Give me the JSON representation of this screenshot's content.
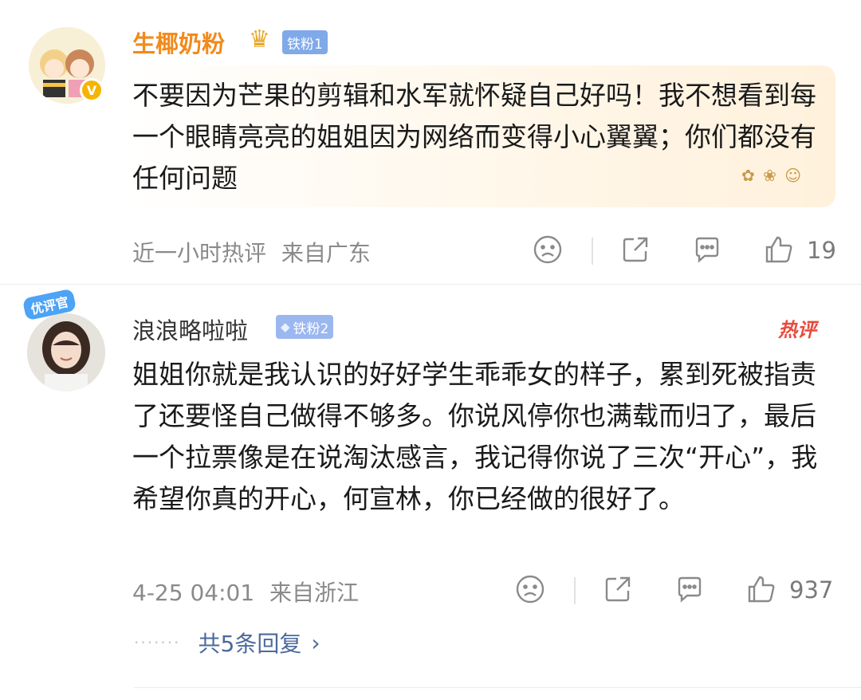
{
  "comments": [
    {
      "username": "生椰奶粉",
      "fan_badge": "铁粉1",
      "text": "不要因为芒果的剪辑和水军就怀疑自己好吗！我不想看到每一个眼睛亮亮的姐姐因为网络而变得小心翼翼；你们都没有任何问题",
      "time": "近一小时热评",
      "location": "来自广东",
      "likes": "19"
    },
    {
      "username": "浪浪略啦啦",
      "fan_badge": "铁粉2",
      "avatar_tag": "优评官",
      "hot_label": "热评",
      "text": "姐姐你就是我认识的好好学生乖乖女的样子，累到死被指责了还要怪自己做得不够多。你说风停你也满载而归了，最后一个拉票像是在说淘汰感言，我记得你说了三次“开心”，我希望你真的开心，何宣林，你已经做的很好了。",
      "time": "4-25 04:01",
      "location": "来自浙江",
      "likes": "937",
      "replies": "共5条回复"
    }
  ],
  "colors": {
    "username_vip": "#f28a1c",
    "reply_link": "#4a6a9c",
    "hot_red": "#e84a3c"
  }
}
